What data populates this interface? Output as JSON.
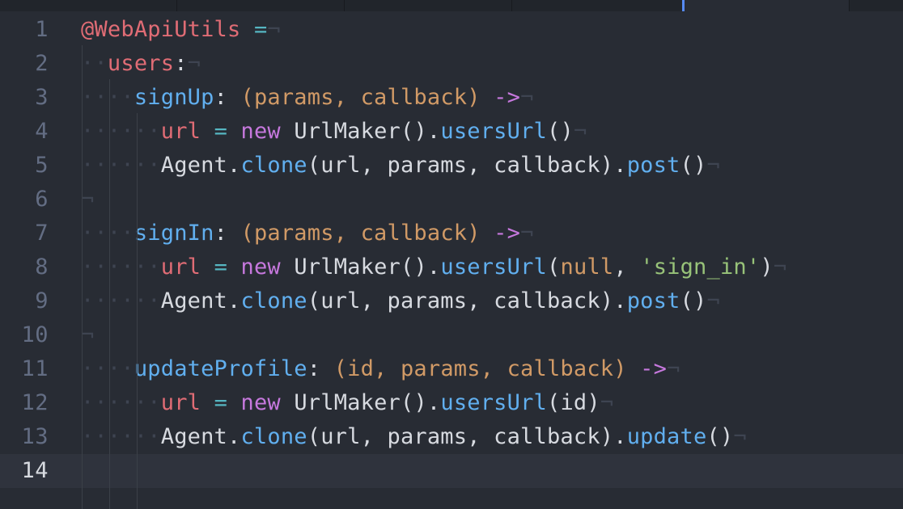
{
  "editor": {
    "lines": [
      {
        "n": "1",
        "tokens": [
          {
            "t": "@WebApiUtils",
            "c": "c-var"
          },
          {
            "t": " ",
            "c": "c-plain"
          },
          {
            "t": "=",
            "c": "c-op"
          },
          {
            "t": "¬",
            "c": "inv"
          }
        ]
      },
      {
        "n": "2",
        "tokens": [
          {
            "t": "··",
            "c": "inv"
          },
          {
            "t": "users",
            "c": "c-var"
          },
          {
            "t": ":",
            "c": "c-plain"
          },
          {
            "t": "¬",
            "c": "inv"
          }
        ]
      },
      {
        "n": "3",
        "tokens": [
          {
            "t": "····",
            "c": "inv"
          },
          {
            "t": "signUp",
            "c": "c-fn"
          },
          {
            "t": ": ",
            "c": "c-plain"
          },
          {
            "t": "(params, callback)",
            "c": "c-param"
          },
          {
            "t": " ",
            "c": "c-plain"
          },
          {
            "t": "->",
            "c": "c-arrow"
          },
          {
            "t": "¬",
            "c": "inv"
          }
        ]
      },
      {
        "n": "4",
        "tokens": [
          {
            "t": "······",
            "c": "inv"
          },
          {
            "t": "url",
            "c": "c-var"
          },
          {
            "t": " ",
            "c": "c-plain"
          },
          {
            "t": "=",
            "c": "c-op"
          },
          {
            "t": " ",
            "c": "c-plain"
          },
          {
            "t": "new",
            "c": "c-kw"
          },
          {
            "t": " UrlMaker().",
            "c": "c-plain"
          },
          {
            "t": "usersUrl",
            "c": "c-fn"
          },
          {
            "t": "()",
            "c": "c-plain"
          },
          {
            "t": "¬",
            "c": "inv"
          }
        ]
      },
      {
        "n": "5",
        "tokens": [
          {
            "t": "······",
            "c": "inv"
          },
          {
            "t": "Agent.",
            "c": "c-plain"
          },
          {
            "t": "clone",
            "c": "c-fn"
          },
          {
            "t": "(url, params, callback).",
            "c": "c-plain"
          },
          {
            "t": "post",
            "c": "c-fn"
          },
          {
            "t": "()",
            "c": "c-plain"
          },
          {
            "t": "¬",
            "c": "inv"
          }
        ]
      },
      {
        "n": "6",
        "tokens": [
          {
            "t": "¬",
            "c": "inv"
          }
        ]
      },
      {
        "n": "7",
        "tokens": [
          {
            "t": "····",
            "c": "inv"
          },
          {
            "t": "signIn",
            "c": "c-fn"
          },
          {
            "t": ": ",
            "c": "c-plain"
          },
          {
            "t": "(params, callback)",
            "c": "c-param"
          },
          {
            "t": " ",
            "c": "c-plain"
          },
          {
            "t": "->",
            "c": "c-arrow"
          },
          {
            "t": "¬",
            "c": "inv"
          }
        ]
      },
      {
        "n": "8",
        "tokens": [
          {
            "t": "······",
            "c": "inv"
          },
          {
            "t": "url",
            "c": "c-var"
          },
          {
            "t": " ",
            "c": "c-plain"
          },
          {
            "t": "=",
            "c": "c-op"
          },
          {
            "t": " ",
            "c": "c-plain"
          },
          {
            "t": "new",
            "c": "c-kw"
          },
          {
            "t": " UrlMaker().",
            "c": "c-plain"
          },
          {
            "t": "usersUrl",
            "c": "c-fn"
          },
          {
            "t": "(",
            "c": "c-plain"
          },
          {
            "t": "null",
            "c": "c-null"
          },
          {
            "t": ", ",
            "c": "c-plain"
          },
          {
            "t": "'sign_in'",
            "c": "c-str"
          },
          {
            "t": ")",
            "c": "c-plain"
          },
          {
            "t": "¬",
            "c": "inv"
          }
        ]
      },
      {
        "n": "9",
        "tokens": [
          {
            "t": "······",
            "c": "inv"
          },
          {
            "t": "Agent.",
            "c": "c-plain"
          },
          {
            "t": "clone",
            "c": "c-fn"
          },
          {
            "t": "(url, params, callback).",
            "c": "c-plain"
          },
          {
            "t": "post",
            "c": "c-fn"
          },
          {
            "t": "()",
            "c": "c-plain"
          },
          {
            "t": "¬",
            "c": "inv"
          }
        ]
      },
      {
        "n": "10",
        "tokens": [
          {
            "t": "¬",
            "c": "inv"
          }
        ]
      },
      {
        "n": "11",
        "tokens": [
          {
            "t": "····",
            "c": "inv"
          },
          {
            "t": "updateProfile",
            "c": "c-fn"
          },
          {
            "t": ": ",
            "c": "c-plain"
          },
          {
            "t": "(id, params, callback)",
            "c": "c-param"
          },
          {
            "t": " ",
            "c": "c-plain"
          },
          {
            "t": "->",
            "c": "c-arrow"
          },
          {
            "t": "¬",
            "c": "inv"
          }
        ]
      },
      {
        "n": "12",
        "tokens": [
          {
            "t": "······",
            "c": "inv"
          },
          {
            "t": "url",
            "c": "c-var"
          },
          {
            "t": " ",
            "c": "c-plain"
          },
          {
            "t": "=",
            "c": "c-op"
          },
          {
            "t": " ",
            "c": "c-plain"
          },
          {
            "t": "new",
            "c": "c-kw"
          },
          {
            "t": " UrlMaker().",
            "c": "c-plain"
          },
          {
            "t": "usersUrl",
            "c": "c-fn"
          },
          {
            "t": "(id)",
            "c": "c-plain"
          },
          {
            "t": "¬",
            "c": "inv"
          }
        ]
      },
      {
        "n": "13",
        "tokens": [
          {
            "t": "······",
            "c": "inv"
          },
          {
            "t": "Agent.",
            "c": "c-plain"
          },
          {
            "t": "clone",
            "c": "c-fn"
          },
          {
            "t": "(url, params, callback).",
            "c": "c-plain"
          },
          {
            "t": "update",
            "c": "c-fn"
          },
          {
            "t": "()",
            "c": "c-plain"
          },
          {
            "t": "¬",
            "c": "inv"
          }
        ]
      },
      {
        "n": "14",
        "tokens": []
      }
    ],
    "cursor_line": "14"
  },
  "colors": {
    "background": "#282c34",
    "cursor_line": "#2f333d",
    "accent": "#568af2"
  }
}
